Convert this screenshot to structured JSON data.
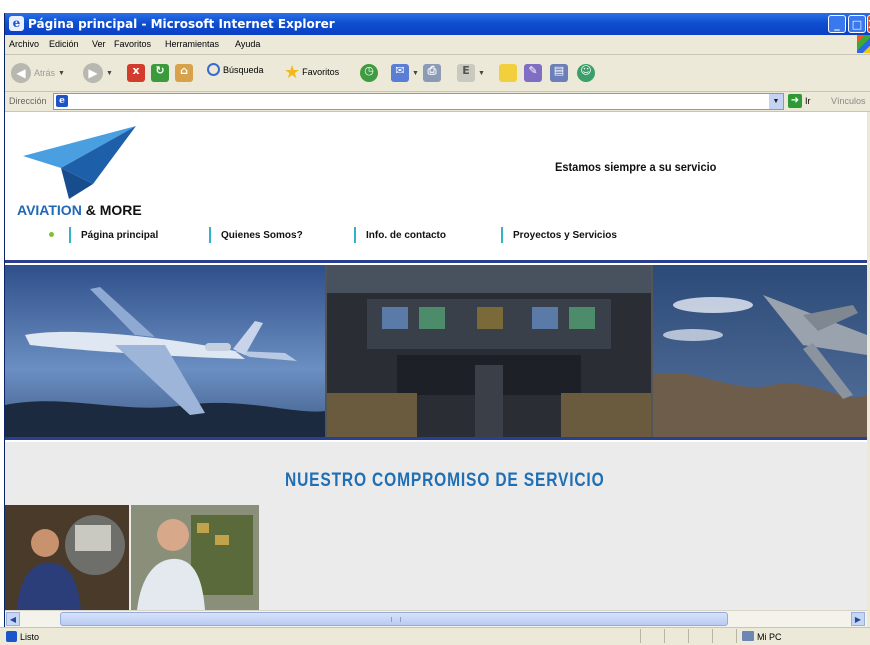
{
  "window": {
    "title": "Página principal - Microsoft Internet Explorer",
    "controls": {
      "minimize": "_",
      "maximize": "□",
      "close": "X"
    }
  },
  "menubar": [
    "Archivo",
    "Edición",
    "Ver",
    "Favoritos",
    "Herramientas",
    "Ayuda"
  ],
  "toolbar": {
    "back_label": "Atrás",
    "search_label": "Búsqueda",
    "favorites_label": "Favoritos"
  },
  "address_bar": {
    "label": "Dirección",
    "value": "",
    "go_label": "Ir",
    "links_label": "Vínculos"
  },
  "page": {
    "brand_main": "AVIATION",
    "brand_amp": "& MORE",
    "slogan": "Estamos siempre a su servicio",
    "nav": [
      "Página principal",
      "Quienes Somos?",
      "Info. de contacto",
      "Proyectos y Servicios"
    ],
    "headline": "NUESTRO COMPROMISO DE SERVICIO",
    "colors": {
      "brand_blue": "#1f67b8",
      "headline_blue": "#1f6fb5",
      "nav_separator": "#35b0c8",
      "rule": "#2a3f8f"
    }
  },
  "status_bar": {
    "text": "Listo",
    "zone": "Mi PC"
  }
}
